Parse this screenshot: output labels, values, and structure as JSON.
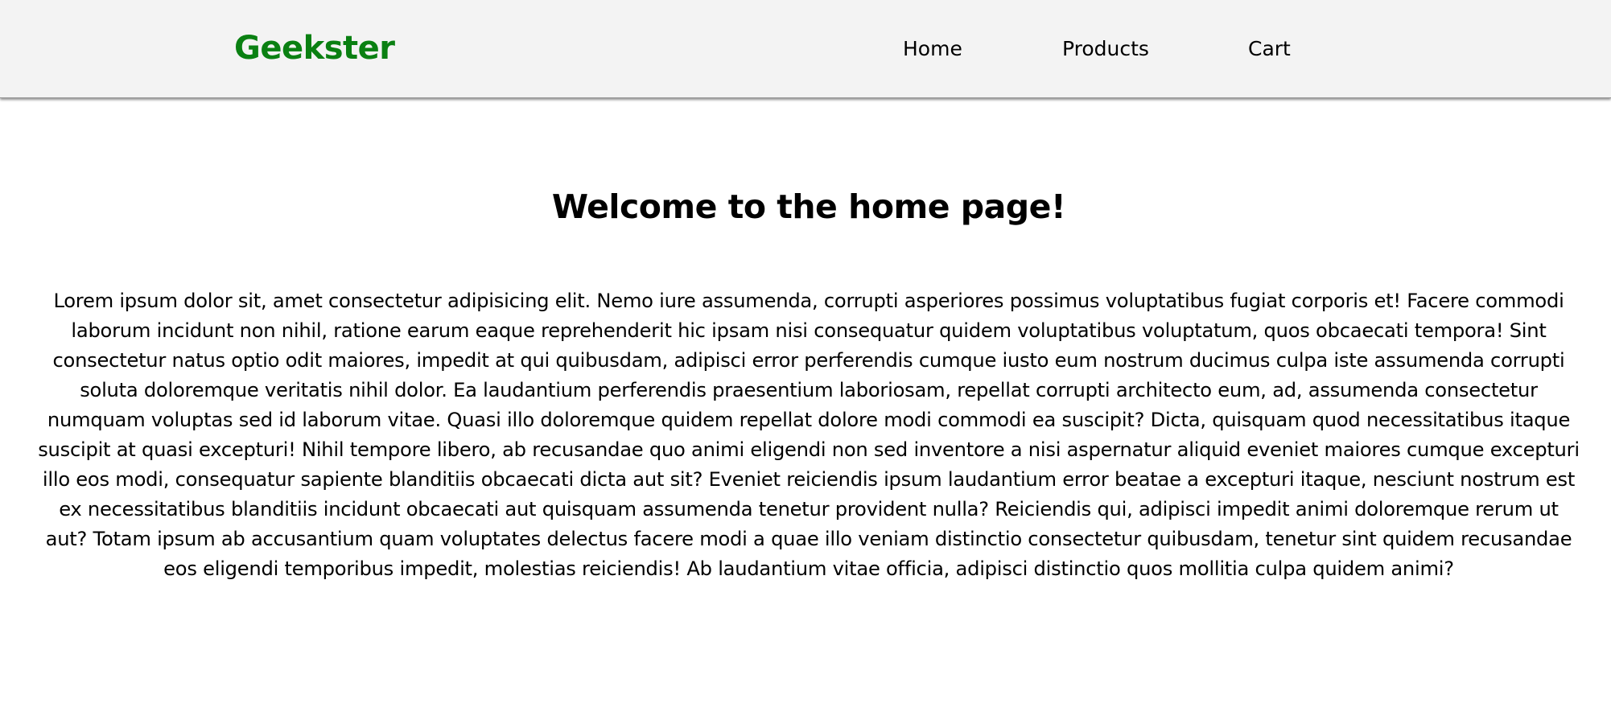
{
  "header": {
    "brand": "Geekster",
    "nav": {
      "home": "Home",
      "products": "Products",
      "cart": "Cart"
    }
  },
  "main": {
    "title": "Welcome to the home page!",
    "body": "Lorem ipsum dolor sit, amet consectetur adipisicing elit. Nemo iure assumenda, corrupti asperiores possimus voluptatibus fugiat corporis et! Facere commodi laborum incidunt non nihil, ratione earum eaque reprehenderit hic ipsam nisi consequatur quidem voluptatibus voluptatum, quos obcaecati tempora! Sint consectetur natus optio odit maiores, impedit at qui quibusdam, adipisci error perferendis cumque iusto eum nostrum ducimus culpa iste assumenda corrupti soluta doloremque veritatis nihil dolor. Ea laudantium perferendis praesentium laboriosam, repellat corrupti architecto eum, ad, assumenda consectetur numquam voluptas sed id laborum vitae. Quasi illo doloremque quidem repellat dolore modi commodi ea suscipit? Dicta, quisquam quod necessitatibus itaque suscipit at quasi excepturi! Nihil tempore libero, ab recusandae quo animi eligendi non sed inventore a nisi aspernatur aliquid eveniet maiores cumque excepturi illo eos modi, consequatur sapiente blanditiis obcaecati dicta aut sit? Eveniet reiciendis ipsum laudantium error beatae a excepturi itaque, nesciunt nostrum est ex necessitatibus blanditiis incidunt obcaecati aut quisquam assumenda tenetur provident nulla? Reiciendis qui, adipisci impedit animi doloremque rerum ut aut? Totam ipsum ab accusantium quam voluptates delectus facere modi a quae illo veniam distinctio consectetur quibusdam, tenetur sint quidem recusandae eos eligendi temporibus impedit, molestias reiciendis! Ab laudantium vitae officia, adipisci distinctio quos mollitia culpa quidem animi?"
  },
  "colors": {
    "brand": "#0a8012",
    "navbar_bg": "#f3f3f3",
    "text": "#000000",
    "page_bg": "#ffffff"
  }
}
